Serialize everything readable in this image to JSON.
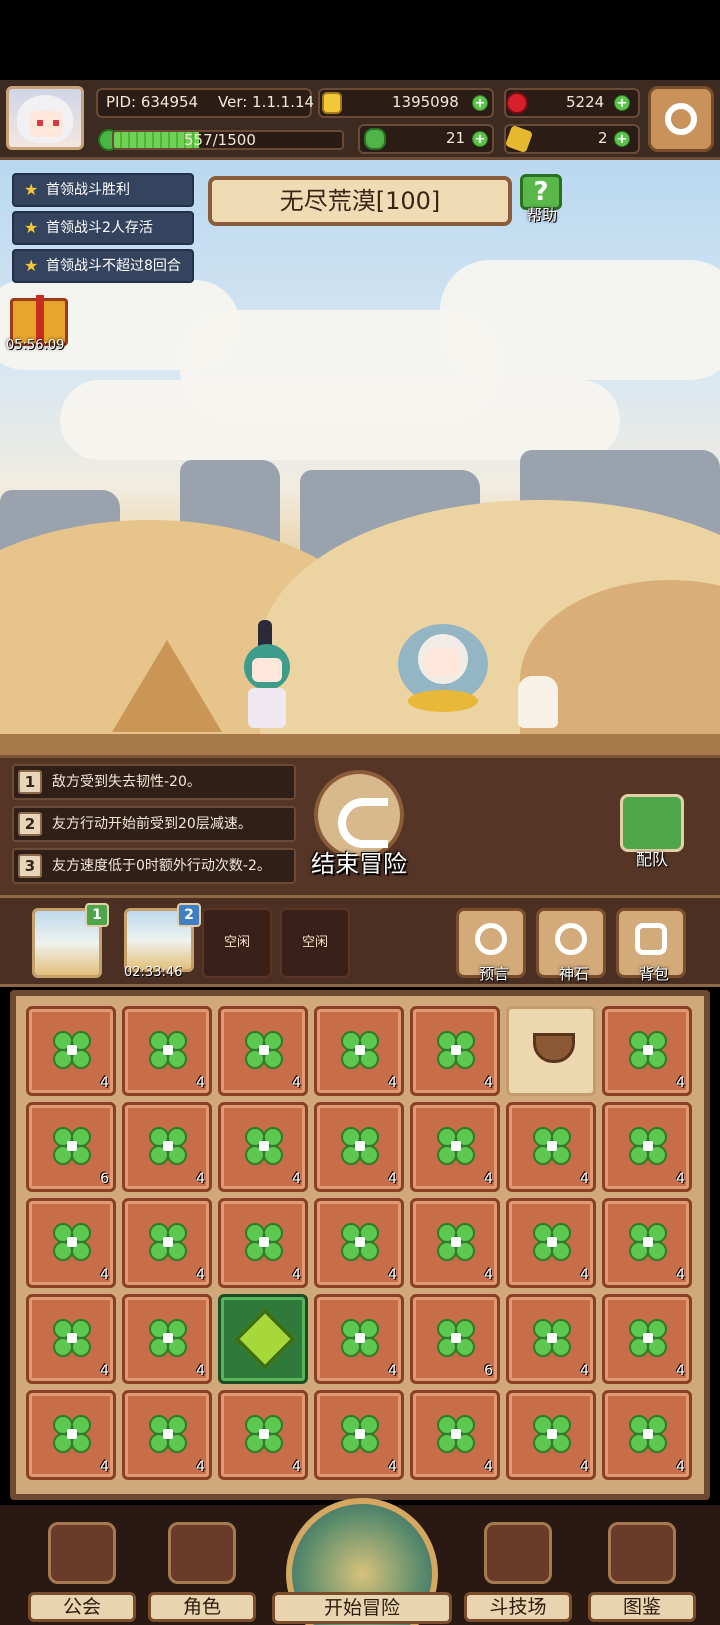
{
  "hud": {
    "pid": "PID: 634954",
    "version": "Ver: 1.1.1.14",
    "gold": "1395098",
    "red_gem": "5224",
    "energy": "557/1500",
    "energy_fraction": 0.371,
    "clover": "21",
    "feather": "2"
  },
  "quests": [
    "首领战斗胜利",
    "首领战斗2人存活",
    "首领战斗不超过8回合"
  ],
  "stage": {
    "title": "无尽荒漠[100]",
    "help_label": "帮助",
    "gift_timer": "05:56:09"
  },
  "effects": [
    {
      "num": "1",
      "text": "敌方受到失去韧性-20。"
    },
    {
      "num": "2",
      "text": "友方行动开始前受到20层减速。"
    },
    {
      "num": "3",
      "text": "友方速度低于0时额外行动次数-2。"
    }
  ],
  "actions": {
    "end_adventure": "结束冒险",
    "team": "配队"
  },
  "slots": {
    "slot1_badge": "1",
    "slot2_badge": "2",
    "slot2_timer": "02:33:46",
    "idle1": "空闲",
    "idle2": "空闲",
    "prophecy": "预言",
    "divine_stone": "神石",
    "backpack": "背包"
  },
  "grid": [
    [
      "4",
      "4",
      "4",
      "4",
      "4",
      "",
      "4"
    ],
    [
      "6",
      "4",
      "4",
      "4",
      "4",
      "4",
      "4"
    ],
    [
      "4",
      "4",
      "4",
      "4",
      "4",
      "4",
      "4"
    ],
    [
      "4",
      "4",
      "",
      "4",
      "6",
      "4",
      "4"
    ],
    [
      "4",
      "4",
      "4",
      "4",
      "4",
      "4",
      "4"
    ]
  ],
  "nav": {
    "guild": "公会",
    "character": "角色",
    "start_adventure": "开始冒险",
    "arena": "斗技场",
    "codex": "图鉴"
  },
  "colors": {
    "clover_green": "#5cc84f",
    "tile_orange": "#c86d4a",
    "quest_blue": "#34435e",
    "accent_brown": "#6d4932"
  }
}
